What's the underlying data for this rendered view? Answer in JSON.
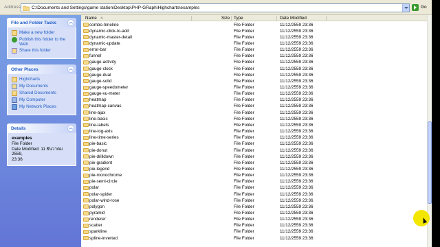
{
  "address": {
    "label": "Address",
    "path": "C:\\Documents and Settings\\game station\\Desktop\\PHP-GRaph\\Highcharts\\examples",
    "go_label": "Go"
  },
  "taskpane": {
    "file_tasks": {
      "title": "File and Folder Tasks",
      "items": [
        {
          "label": "Make a new folder",
          "icon": "new-folder-icon"
        },
        {
          "label": "Publish this folder to the Web",
          "icon": "globe-icon"
        },
        {
          "label": "Share this folder",
          "icon": "share-icon"
        }
      ]
    },
    "other_places": {
      "title": "Other Places",
      "items": [
        {
          "label": "Highcharts",
          "icon": "folder-icon"
        },
        {
          "label": "My Documents",
          "icon": "documents-icon"
        },
        {
          "label": "Shared Documents",
          "icon": "folder-icon"
        },
        {
          "label": "My Computer",
          "icon": "computer-icon"
        },
        {
          "label": "My Network Places",
          "icon": "network-icon"
        }
      ]
    },
    "details": {
      "title": "Details",
      "name": "examples",
      "type": "File Folder",
      "modified_line1": "Date Modified: 11 ธันวาคม 2559,",
      "modified_line2": "23:36"
    }
  },
  "filelist": {
    "columns": {
      "name": "Name",
      "size": "Size",
      "type": "Type",
      "date": "Date Modified"
    },
    "rows": [
      {
        "name": "combo-timeline",
        "type": "File Folder",
        "date": "11/12/2559 23:36"
      },
      {
        "name": "dynamic-click-to-add",
        "type": "File Folder",
        "date": "11/12/2559 23:36"
      },
      {
        "name": "dynamic-master-detail",
        "type": "File Folder",
        "date": "11/12/2559 23:36"
      },
      {
        "name": "dynamic-update",
        "type": "File Folder",
        "date": "11/12/2559 23:36"
      },
      {
        "name": "error-bar",
        "type": "File Folder",
        "date": "11/12/2559 23:36"
      },
      {
        "name": "funnel",
        "type": "File Folder",
        "date": "11/12/2559 23:36"
      },
      {
        "name": "gauge-activity",
        "type": "File Folder",
        "date": "11/12/2559 23:36"
      },
      {
        "name": "gauge-clock",
        "type": "File Folder",
        "date": "11/12/2559 23:36"
      },
      {
        "name": "gauge-dual",
        "type": "File Folder",
        "date": "11/12/2559 23:36"
      },
      {
        "name": "gauge-solid",
        "type": "File Folder",
        "date": "11/12/2559 23:36"
      },
      {
        "name": "gauge-speedometer",
        "type": "File Folder",
        "date": "11/12/2559 23:36"
      },
      {
        "name": "gauge-vu-meter",
        "type": "File Folder",
        "date": "11/12/2559 23:36"
      },
      {
        "name": "heatmap",
        "type": "File Folder",
        "date": "11/12/2559 23:36"
      },
      {
        "name": "heatmap-canvas",
        "type": "File Folder",
        "date": "11/12/2559 23:36"
      },
      {
        "name": "line-ajax",
        "type": "File Folder",
        "date": "11/12/2559 23:36"
      },
      {
        "name": "line-basic",
        "type": "File Folder",
        "date": "11/12/2559 23:36"
      },
      {
        "name": "line-labels",
        "type": "File Folder",
        "date": "11/12/2559 23:36"
      },
      {
        "name": "line-log-axis",
        "type": "File Folder",
        "date": "11/12/2559 23:36"
      },
      {
        "name": "line-time-series",
        "type": "File Folder",
        "date": "11/12/2559 23:36"
      },
      {
        "name": "pie-basic",
        "type": "File Folder",
        "date": "11/12/2559 23:36"
      },
      {
        "name": "pie-donut",
        "type": "File Folder",
        "date": "11/12/2559 23:36"
      },
      {
        "name": "pie-drilldown",
        "type": "File Folder",
        "date": "11/12/2559 23:36"
      },
      {
        "name": "pie-gradient",
        "type": "File Folder",
        "date": "11/12/2559 23:36"
      },
      {
        "name": "pie-legend",
        "type": "File Folder",
        "date": "11/12/2559 23:36"
      },
      {
        "name": "pie-monochrome",
        "type": "File Folder",
        "date": "11/12/2559 23:36"
      },
      {
        "name": "pie-semi-circle",
        "type": "File Folder",
        "date": "11/12/2559 23:36"
      },
      {
        "name": "polar",
        "type": "File Folder",
        "date": "11/12/2559 23:36"
      },
      {
        "name": "polar-spider",
        "type": "File Folder",
        "date": "11/12/2559 23:36"
      },
      {
        "name": "polar-wind-rose",
        "type": "File Folder",
        "date": "11/12/2559 23:36"
      },
      {
        "name": "polygon",
        "type": "File Folder",
        "date": "11/12/2559 23:36"
      },
      {
        "name": "pyramid",
        "type": "File Folder",
        "date": "11/12/2559 23:36"
      },
      {
        "name": "renderer",
        "type": "File Folder",
        "date": "11/12/2559 23:36"
      },
      {
        "name": "scatter",
        "type": "File Folder",
        "date": "11/12/2559 23:36"
      },
      {
        "name": "sparkline",
        "type": "File Folder",
        "date": "11/12/2559 23:36"
      },
      {
        "name": "spline-inverted",
        "type": "File Folder",
        "date": "11/12/2559 23:36"
      }
    ]
  }
}
